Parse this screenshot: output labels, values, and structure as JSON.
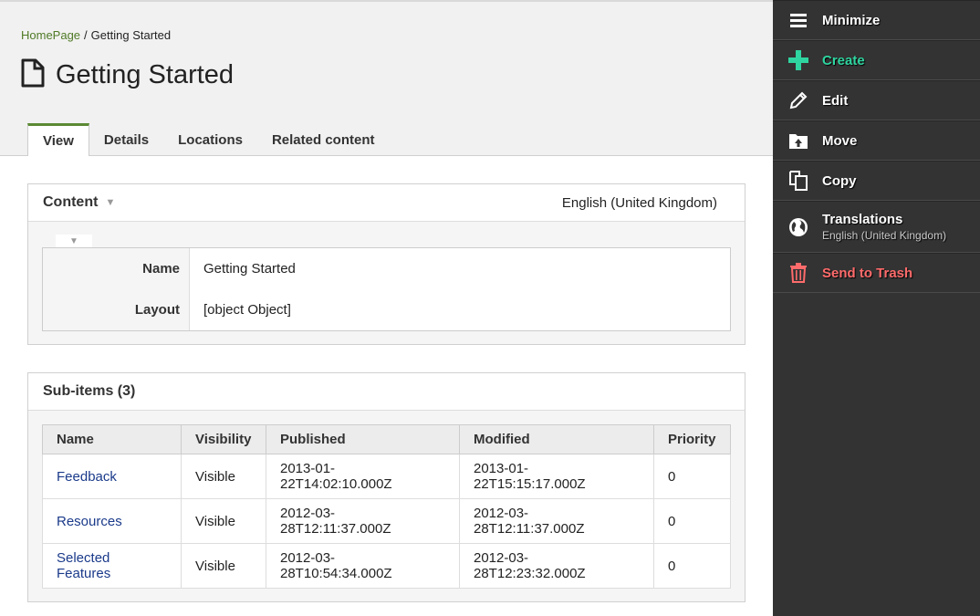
{
  "breadcrumb": {
    "home": "HomePage",
    "separator": "/",
    "current": "Getting Started"
  },
  "page": {
    "title": "Getting Started"
  },
  "tabs": [
    "View",
    "Details",
    "Locations",
    "Related content"
  ],
  "content_panel": {
    "title": "Content",
    "language": "English (United Kingdom)",
    "fields": [
      {
        "label": "Name",
        "value": "Getting Started"
      },
      {
        "label": "Layout",
        "value": "[object Object]"
      }
    ]
  },
  "subitems": {
    "title": "Sub-items (3)",
    "columns": [
      "Name",
      "Visibility",
      "Published",
      "Modified",
      "Priority"
    ],
    "rows": [
      {
        "name": "Feedback",
        "visibility": "Visible",
        "published_a": "2013-01-",
        "published_b": "22T14:02:10.000Z",
        "modified_a": "2013-01-",
        "modified_b": "22T15:15:17.000Z",
        "priority": "0"
      },
      {
        "name": "Resources",
        "visibility": "Visible",
        "published_a": "2012-03-",
        "published_b": "28T12:11:37.000Z",
        "modified_a": "2012-03-",
        "modified_b": "28T12:11:37.000Z",
        "priority": "0"
      },
      {
        "name_a": "Selected",
        "name_b": "Features",
        "visibility": "Visible",
        "published_a": "2012-03-",
        "published_b": "28T10:54:34.000Z",
        "modified_a": "2012-03-",
        "modified_b": "28T12:23:32.000Z",
        "priority": "0"
      }
    ]
  },
  "sidebar": {
    "minimize": "Minimize",
    "create": "Create",
    "edit": "Edit",
    "move": "Move",
    "copy": "Copy",
    "translations": "Translations",
    "translations_sub": "English (United Kingdom)",
    "trash": "Send to Trash"
  },
  "colors": {
    "accent_green": "#5b8a33",
    "create": "#2fd5a0",
    "trash": "#ff6b6b",
    "sidebar_bg": "#333333",
    "link": "#1a3a8a"
  }
}
